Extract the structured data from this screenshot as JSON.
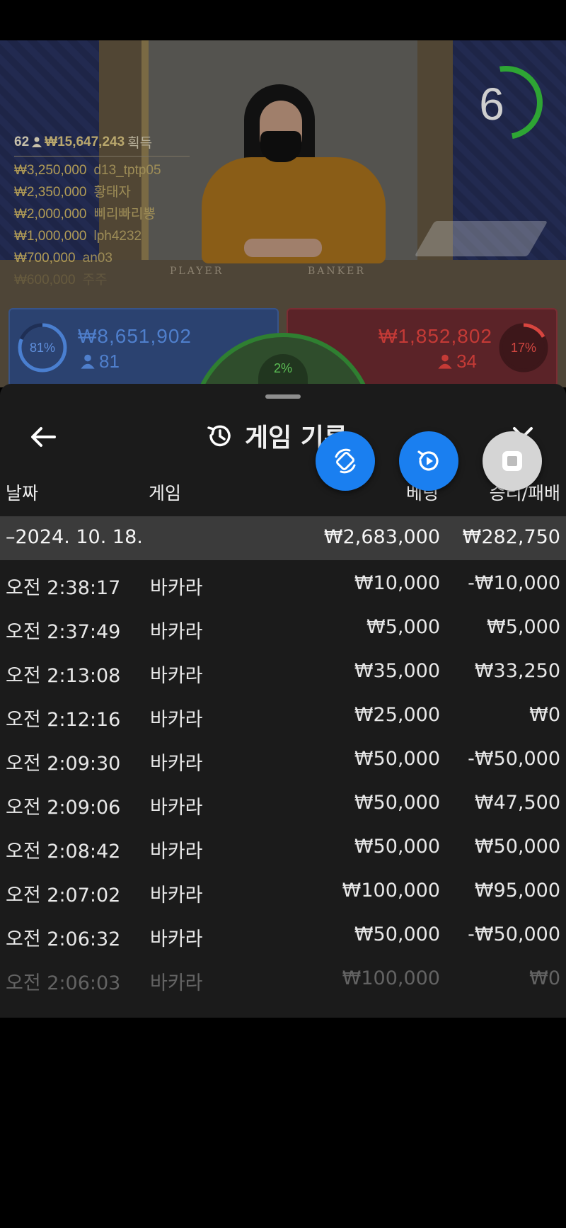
{
  "stage": {
    "table_player_label": "PLAYER",
    "table_banker_label": "BANKER",
    "countdown": "6",
    "countdown_color": "#2ea534"
  },
  "winners": {
    "count": "62",
    "total": "₩15,647,243",
    "label": "획득",
    "rows": [
      {
        "amount": "₩3,250,000",
        "name": "d13_tptp05"
      },
      {
        "amount": "₩2,350,000",
        "name": "황태자"
      },
      {
        "amount": "₩2,000,000",
        "name": "삐리빠리뽕"
      },
      {
        "amount": "₩1,000,000",
        "name": "lph4232"
      },
      {
        "amount": "₩700,000",
        "name": "an03"
      },
      {
        "amount": "₩600,000",
        "name": "주주"
      }
    ]
  },
  "player_bets": {
    "percent": 0.81,
    "percent_label": "81%",
    "amount": "₩8,651,902",
    "people": "81",
    "color": "#4a7fd0"
  },
  "banker_bets": {
    "percent": 0.17,
    "percent_label": "17%",
    "amount": "₩1,852,802",
    "people": "34",
    "color": "#d8453f"
  },
  "tie_bets": {
    "percent_label": "2%",
    "color": "#5cbf55"
  },
  "sheet": {
    "title": "게임 기록",
    "columns": {
      "date": "날짜",
      "game": "게임",
      "bet": "베팅",
      "result": "승리/패배"
    },
    "day": {
      "date": "–2024. 10. 18.",
      "bet": "₩2,683,000",
      "result": "₩282,750"
    },
    "rows": [
      {
        "time": "오전 2:38:17",
        "game": "바카라",
        "bet": "₩10,000",
        "result": "-₩10,000"
      },
      {
        "time": "오전 2:37:49",
        "game": "바카라",
        "bet": "₩5,000",
        "result": "₩5,000"
      },
      {
        "time": "오전 2:13:08",
        "game": "바카라",
        "bet": "₩35,000",
        "result": "₩33,250"
      },
      {
        "time": "오전 2:12:16",
        "game": "바카라",
        "bet": "₩25,000",
        "result": "₩0"
      },
      {
        "time": "오전 2:09:30",
        "game": "바카라",
        "bet": "₩50,000",
        "result": "-₩50,000"
      },
      {
        "time": "오전 2:09:06",
        "game": "바카라",
        "bet": "₩50,000",
        "result": "₩47,500"
      },
      {
        "time": "오전 2:08:42",
        "game": "바카라",
        "bet": "₩50,000",
        "result": "₩50,000"
      },
      {
        "time": "오전 2:07:02",
        "game": "바카라",
        "bet": "₩100,000",
        "result": "₩95,000"
      },
      {
        "time": "오전 2:06:32",
        "game": "바카라",
        "bet": "₩50,000",
        "result": "-₩50,000"
      },
      {
        "time": "오전 2:06:03",
        "game": "바카라",
        "bet": "₩100,000",
        "result": "₩0"
      }
    ],
    "icons": {
      "back": "arrow-left-icon",
      "history": "history-icon",
      "close": "close-icon"
    }
  },
  "floating_buttons": {
    "rotate_icon": "rotate-icon",
    "replay_icon": "replay-icon",
    "stop_icon": "stop-icon",
    "accent": "#1a7ff0"
  }
}
